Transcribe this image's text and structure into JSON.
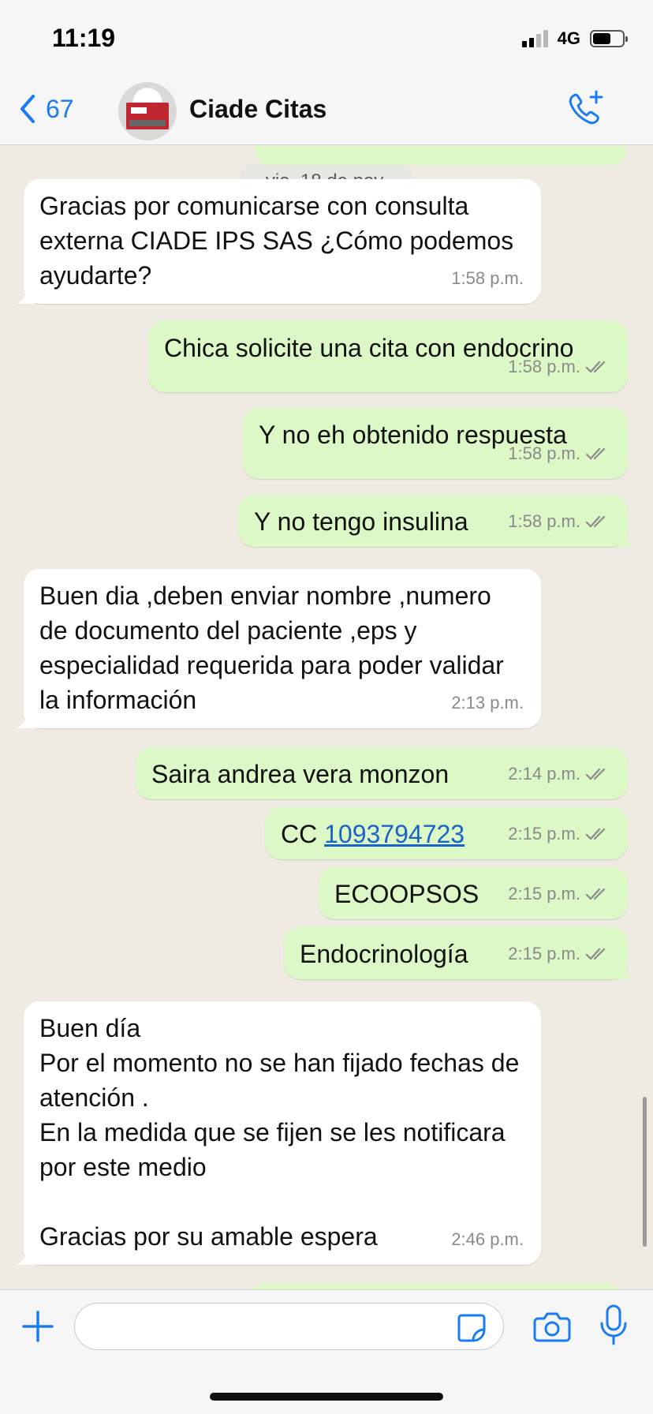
{
  "status_bar": {
    "time": "11:19",
    "network": "4G"
  },
  "header": {
    "back_count": "67",
    "contact_name": "Ciade Citas"
  },
  "chat": {
    "date_chip": "vie, 18 de nov.",
    "messages": [
      {
        "dir": "in",
        "text": "Gracias por comunicarse con consulta externa CIADE IPS SAS ¿Cómo podemos ayudarte?",
        "time": "1:58 p.m."
      },
      {
        "dir": "out",
        "text": "Chica solicite una cita con endocrino",
        "time": "1:58 p.m."
      },
      {
        "dir": "out",
        "text": "Y no eh obtenido respuesta",
        "time": "1:58 p.m."
      },
      {
        "dir": "out",
        "text": "Y no tengo insulina",
        "time": "1:58 p.m."
      },
      {
        "dir": "in",
        "text": "Buen dia ,deben enviar nombre ,numero de documento del paciente ,eps y especialidad requerida para poder validar la información",
        "time": "2:13 p.m."
      },
      {
        "dir": "out",
        "text": "Saira andrea vera monzon",
        "time": "2:14 p.m."
      },
      {
        "dir": "out",
        "prefix": "CC ",
        "link": "1093794723",
        "time": "2:15 p.m."
      },
      {
        "dir": "out",
        "text": "ECOOPSOS",
        "time": "2:15 p.m."
      },
      {
        "dir": "out",
        "text": "Endocrinología",
        "time": "2:15 p.m."
      },
      {
        "dir": "in",
        "lines": [
          "Buen día",
          "Por el momento no se han fijado fechas de atención .",
          "En la medida que se fijen se les notificara por este medio",
          "",
          "Gracias por su amable espera"
        ],
        "time": "2:46 p.m."
      }
    ]
  },
  "colors": {
    "incoming": "#ffffff",
    "outgoing": "#dcf8c6",
    "accent": "#1a7cf5",
    "background": "#efeae2"
  },
  "icons": {
    "back": "chevron-left-icon",
    "call": "phone-plus-icon",
    "attach": "plus-icon",
    "sticker": "sticker-icon",
    "camera": "camera-icon",
    "mic": "microphone-icon"
  }
}
